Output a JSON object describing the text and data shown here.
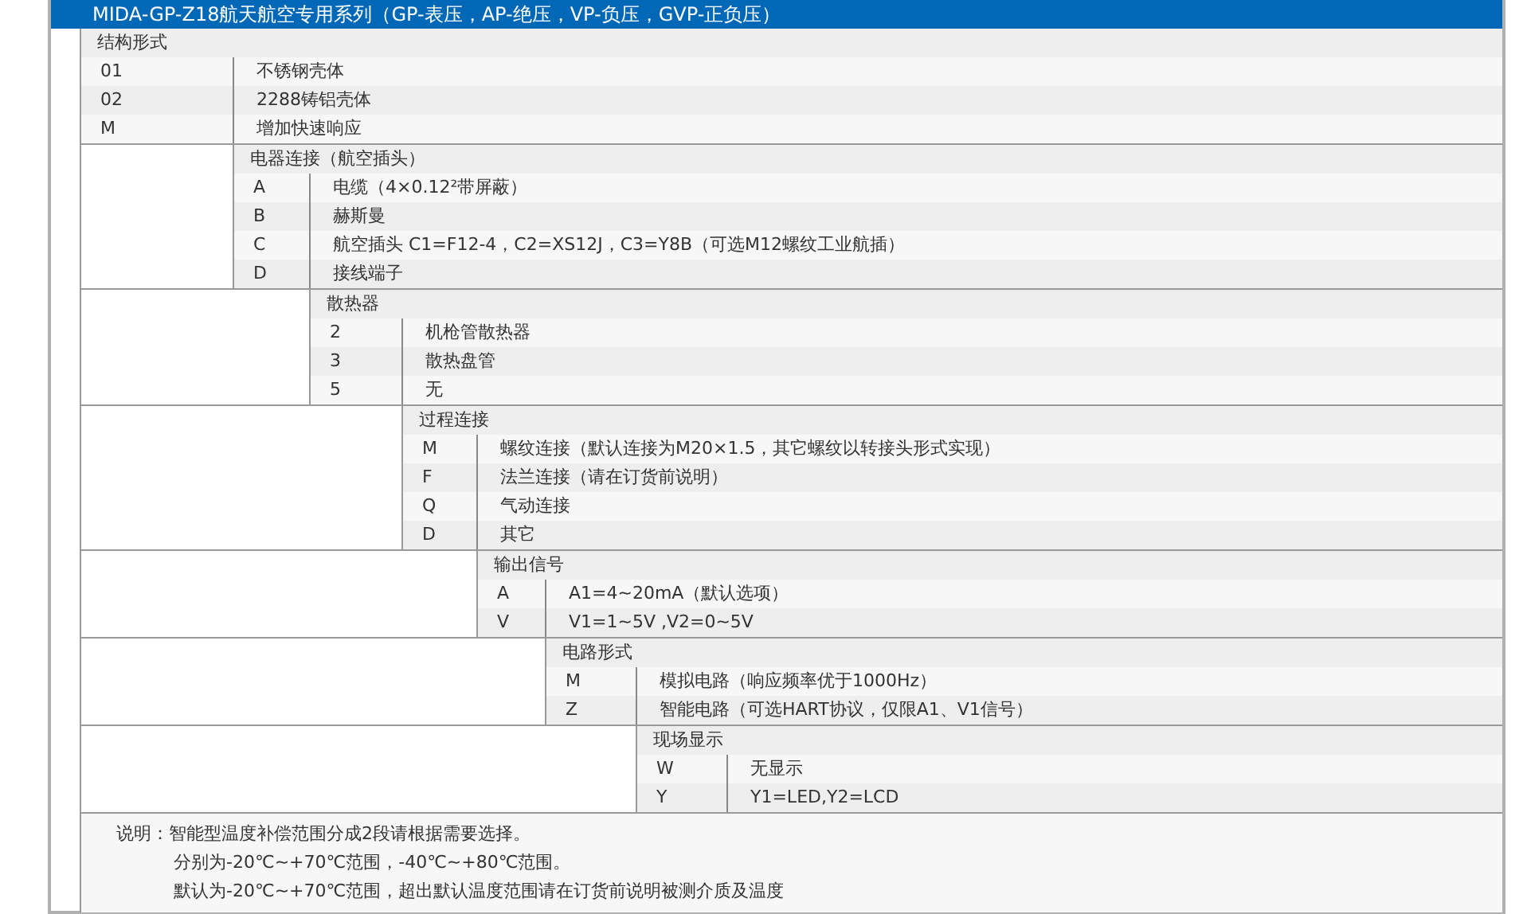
{
  "title": "MIDA-GP-Z18航天航空专用系列（GP-表压，AP-绝压，VP-负压，GVP-正负压）",
  "sections": [
    {
      "header": "结构形式",
      "options": [
        {
          "code": "01",
          "description": "不锈钢壳体"
        },
        {
          "code": "02",
          "description": "2288铸铝壳体"
        },
        {
          "code": "M",
          "description": "增加快速响应"
        }
      ]
    },
    {
      "header": "电器连接（航空插头）",
      "options": [
        {
          "code": "A",
          "description": "电缆（4×0.12²带屏蔽）"
        },
        {
          "code": "B",
          "description": "赫斯曼"
        },
        {
          "code": "C",
          "description": "航空插头 C1=F12-4，C2=XS12J，C3=Y8B（可选M12螺纹工业航插）"
        },
        {
          "code": "D",
          "description": "接线端子"
        }
      ]
    },
    {
      "header": "散热器",
      "options": [
        {
          "code": "2",
          "description": "机枪管散热器"
        },
        {
          "code": "3",
          "description": "散热盘管"
        },
        {
          "code": "5",
          "description": "无"
        }
      ]
    },
    {
      "header": "过程连接",
      "options": [
        {
          "code": "M",
          "description": "螺纹连接（默认连接为M20×1.5，其它螺纹以转接头形式实现）"
        },
        {
          "code": "F",
          "description": "法兰连接（请在订货前说明）"
        },
        {
          "code": "Q",
          "description": "气动连接"
        },
        {
          "code": "D",
          "description": "其它"
        }
      ]
    },
    {
      "header": "输出信号",
      "options": [
        {
          "code": "A",
          "description": "A1=4~20mA（默认选项）"
        },
        {
          "code": "V",
          "description": "V1=1~5V ,V2=0~5V"
        }
      ]
    },
    {
      "header": "电路形式",
      "options": [
        {
          "code": "M",
          "description": "模拟电路（响应频率优于1000Hz）"
        },
        {
          "code": "Z",
          "description": "智能电路（可选HART协议，仅限A1、V1信号）"
        }
      ]
    },
    {
      "header": "现场显示",
      "options": [
        {
          "code": "W",
          "description": "无显示"
        },
        {
          "code": "Y",
          "description": "Y1=LED,Y2=LCD"
        }
      ]
    }
  ],
  "notes": {
    "label": "说明：",
    "lines": [
      "智能型温度补偿范围分成2段请根据需要选择。",
      "分别为-20℃~+70℃范围，-40℃~+80℃范围。",
      "默认为-20℃~+70℃范围，超出默认温度范围请在订货前说明被测介质及温度"
    ]
  }
}
